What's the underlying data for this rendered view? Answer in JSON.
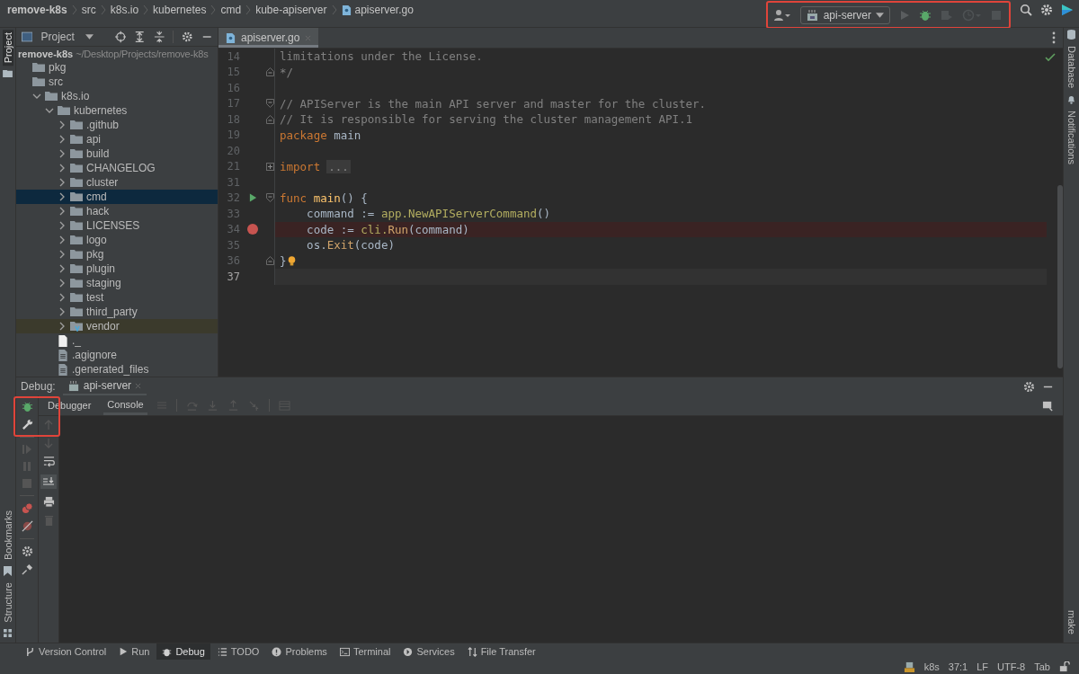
{
  "breadcrumbs": [
    {
      "label": "remove-k8s",
      "kind": "project"
    },
    {
      "label": "src",
      "kind": "folder"
    },
    {
      "label": "k8s.io",
      "kind": "folder"
    },
    {
      "label": "kubernetes",
      "kind": "folder"
    },
    {
      "label": "cmd",
      "kind": "folder"
    },
    {
      "label": "kube-apiserver",
      "kind": "folder"
    },
    {
      "label": "apiserver.go",
      "kind": "file"
    }
  ],
  "toolbar": {
    "run_config": "api-server",
    "highlight": true
  },
  "left_stripe": {
    "top": [
      {
        "label": "Project",
        "selected": true
      }
    ],
    "bottom": [
      {
        "label": "Bookmarks"
      },
      {
        "label": "Structure"
      }
    ]
  },
  "right_stripe": [
    {
      "label": "Database"
    },
    {
      "label": "Notifications"
    }
  ],
  "right_stripe_bottom": "make",
  "project_panel": {
    "title": "Project",
    "root": {
      "name": "remove-k8s",
      "path": "~/Desktop/Projects/remove-k8s"
    },
    "tree": [
      {
        "name": "pkg",
        "kind": "folder"
      },
      {
        "name": "src",
        "kind": "folder"
      },
      {
        "name": "k8s.io",
        "kind": "folder",
        "expanded": true,
        "selected": false,
        "children": [
          {
            "name": "kubernetes",
            "kind": "folder",
            "expanded": true,
            "selected": false,
            "children": [
              {
                "name": ".github",
                "kind": "folder",
                "expanded": false,
                "selected": false
              },
              {
                "name": "api",
                "kind": "folder",
                "expanded": false,
                "selected": false
              },
              {
                "name": "build",
                "kind": "folder",
                "expanded": false,
                "selected": false
              },
              {
                "name": "CHANGELOG",
                "kind": "folder",
                "expanded": false,
                "selected": false
              },
              {
                "name": "cluster",
                "kind": "folder",
                "expanded": false,
                "selected": false
              },
              {
                "name": "cmd",
                "kind": "folder",
                "expanded": false,
                "selected": true
              },
              {
                "name": "hack",
                "kind": "folder",
                "expanded": false,
                "selected": false
              },
              {
                "name": "LICENSES",
                "kind": "folder",
                "expanded": false,
                "selected": false
              },
              {
                "name": "logo",
                "kind": "folder",
                "expanded": false,
                "selected": false
              },
              {
                "name": "pkg",
                "kind": "folder",
                "expanded": false,
                "selected": false
              },
              {
                "name": "plugin",
                "kind": "folder",
                "expanded": false,
                "selected": false
              },
              {
                "name": "staging",
                "kind": "folder",
                "expanded": false,
                "selected": false
              },
              {
                "name": "test",
                "kind": "folder",
                "expanded": false,
                "selected": false
              },
              {
                "name": "third_party",
                "kind": "folder",
                "expanded": false,
                "selected": false
              },
              {
                "name": "vendor",
                "kind": "vendor",
                "expanded": false,
                "selected": false
              },
              {
                "name": "._",
                "kind": "file"
              },
              {
                "name": ".agignore",
                "kind": "textfile"
              },
              {
                "name": ".generated_files",
                "kind": "textfile"
              }
            ]
          }
        ]
      }
    ]
  },
  "editor": {
    "tabs": [
      {
        "label": "apiserver.go",
        "selected": true
      }
    ],
    "lines": [
      {
        "number": "14",
        "runnable": false,
        "breakpoint": false,
        "fold_start": false,
        "fold_end": false,
        "bulb": false,
        "current": false,
        "tokens": [
          {
            "text": "limitations under the License.",
            "kind": "comment"
          }
        ]
      },
      {
        "number": "15",
        "runnable": false,
        "breakpoint": false,
        "fold_start": false,
        "fold_end": true,
        "bulb": false,
        "current": false,
        "tokens": [
          {
            "text": "*/",
            "kind": "comment"
          }
        ]
      },
      {
        "number": "16",
        "runnable": false,
        "breakpoint": false,
        "fold_start": false,
        "fold_end": false,
        "bulb": false,
        "current": false
      },
      {
        "number": "17",
        "runnable": false,
        "breakpoint": false,
        "fold_start": true,
        "fold_end": false,
        "bulb": false,
        "current": false,
        "tokens": [
          {
            "text": "// APIServer is the main API server and master for the cluster.",
            "kind": "comment"
          }
        ]
      },
      {
        "number": "18",
        "runnable": false,
        "breakpoint": false,
        "fold_start": false,
        "fold_end": true,
        "bulb": false,
        "current": false,
        "tokens": [
          {
            "text": "// It is responsible for serving the cluster management API.1",
            "kind": "comment"
          }
        ]
      },
      {
        "number": "19",
        "runnable": false,
        "breakpoint": false,
        "fold_start": false,
        "fold_end": false,
        "bulb": false,
        "current": false,
        "tokens": [
          {
            "text": "package",
            "kind": "keyword"
          },
          {
            "text": " main",
            "kind": "plain"
          }
        ]
      },
      {
        "number": "20",
        "runnable": false,
        "breakpoint": false,
        "fold_start": false,
        "fold_end": false,
        "bulb": false,
        "current": false
      },
      {
        "number": "21",
        "runnable": false,
        "breakpoint": false,
        "fold_start": false,
        "fold_end": false,
        "bulb": false,
        "current": false,
        "tokens": [
          {
            "text": "import",
            "kind": "keyword"
          },
          {
            "text": "...",
            "kind": "folded"
          }
        ]
      },
      {
        "number": "31",
        "runnable": false,
        "breakpoint": false,
        "fold_start": false,
        "fold_end": false,
        "bulb": false,
        "current": false
      },
      {
        "number": "32",
        "runnable": true,
        "breakpoint": false,
        "fold_start": true,
        "fold_end": false,
        "bulb": false,
        "current": false,
        "tokens": [
          {
            "text": "func",
            "kind": "keyword"
          },
          {
            "text": " main",
            "kind": "funcname"
          },
          {
            "text": "() {",
            "kind": "plain"
          }
        ]
      },
      {
        "number": "33",
        "runnable": false,
        "breakpoint": false,
        "fold_start": false,
        "fold_end": false,
        "bulb": false,
        "current": false,
        "tokens": [
          {
            "text": "    command := ",
            "kind": "plain"
          },
          {
            "text": "app.NewAPIServerCommand",
            "kind": "package"
          },
          {
            "text": "()",
            "kind": "plain"
          }
        ]
      },
      {
        "number": "34",
        "runnable": false,
        "breakpoint": true,
        "fold_start": false,
        "fold_end": false,
        "bulb": false,
        "current": false,
        "tokens": [
          {
            "text": "    code := ",
            "kind": "plain"
          },
          {
            "text": "cli.",
            "kind": "package"
          },
          {
            "text": "Run",
            "kind": "call"
          },
          {
            "text": "(command)",
            "kind": "plain"
          }
        ]
      },
      {
        "number": "35",
        "runnable": false,
        "breakpoint": false,
        "fold_start": false,
        "fold_end": false,
        "bulb": false,
        "current": false,
        "tokens": [
          {
            "text": "    os.",
            "kind": "plain"
          },
          {
            "text": "Exit",
            "kind": "call"
          },
          {
            "text": "(code)",
            "kind": "plain"
          }
        ]
      },
      {
        "number": "36",
        "runnable": false,
        "breakpoint": false,
        "fold_start": false,
        "fold_end": true,
        "bulb": true,
        "current": false,
        "tokens": [
          {
            "text": "}",
            "kind": "plain"
          }
        ]
      },
      {
        "number": "37",
        "runnable": false,
        "breakpoint": false,
        "fold_start": false,
        "fold_end": false,
        "bulb": false,
        "current": true
      }
    ]
  },
  "debug": {
    "title": "Debug:",
    "session": "api-server",
    "highlight": true,
    "tabs": [
      {
        "label": "Debugger",
        "selected": false
      },
      {
        "label": "Console",
        "selected": true
      }
    ]
  },
  "tool_windows": [
    {
      "label": "Version Control",
      "selected": false
    },
    {
      "label": "Run",
      "selected": false
    },
    {
      "label": "Debug",
      "selected": true
    },
    {
      "label": "TODO",
      "selected": false
    },
    {
      "label": "Problems",
      "selected": false
    },
    {
      "label": "Terminal",
      "selected": false
    },
    {
      "label": "Services",
      "selected": false
    },
    {
      "label": "File Transfer",
      "selected": false
    }
  ],
  "status_bar": [
    "k8s",
    "37:1",
    "LF",
    "UTF-8",
    "Tab"
  ]
}
